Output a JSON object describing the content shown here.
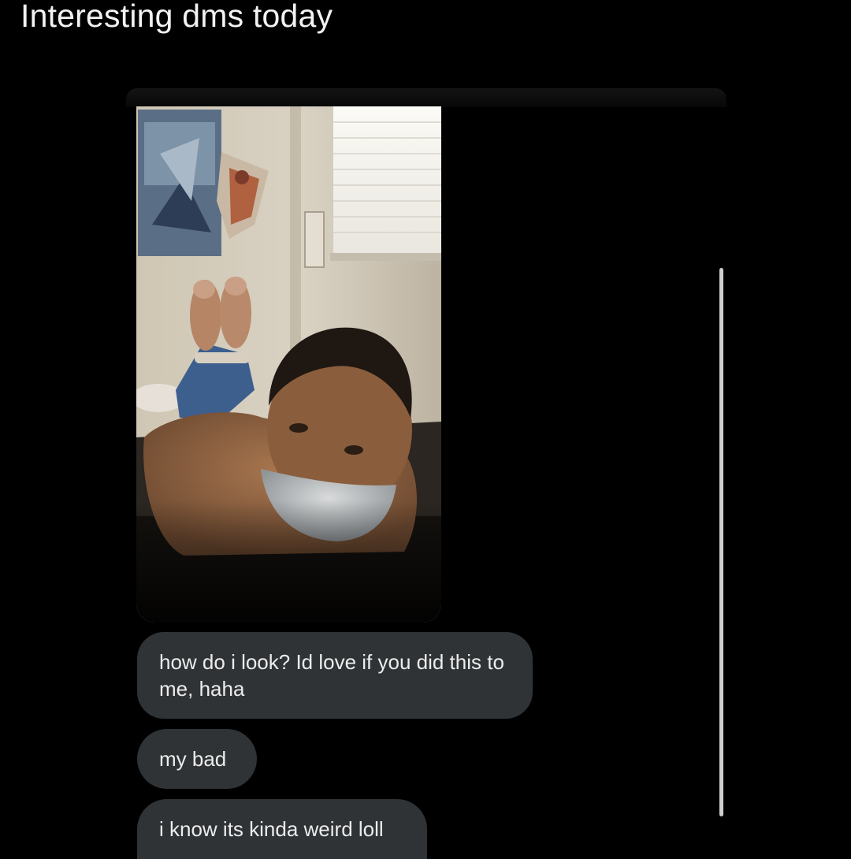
{
  "caption": "Interesting dms today",
  "conversation": {
    "attachment": {
      "kind": "photo"
    },
    "messages": [
      {
        "text": "how do i look? Id love if you did this to me, haha"
      },
      {
        "text": "my bad"
      },
      {
        "text": "i know its kinda weird loll"
      }
    ]
  },
  "colors": {
    "background": "#000000",
    "bubble": "#2f3336",
    "bubble_text": "#ececec",
    "scrollbar": "#cfcfcf"
  }
}
